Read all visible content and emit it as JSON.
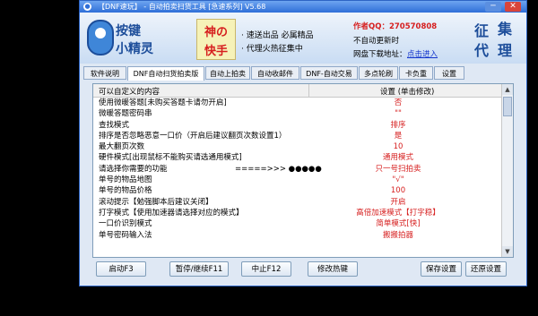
{
  "window": {
    "title": "【DNF速玩】 - 自动拍卖扫货工具 [急速系列] V5.68",
    "title_buttons": [
      "─",
      "✕"
    ]
  },
  "banner": {
    "logo_line1": "按键",
    "logo_line2": "小精灵",
    "shen_line1": "神の",
    "shen_line2": "快手",
    "promo1": "· 速送出品 必属精品",
    "promo2": "· 代理火热征集中",
    "author": "作者QQ：270570808",
    "auto_update": "不自动更新时",
    "download_label": "网盘下载地址：",
    "download_link": "点击进入",
    "zs_chars": [
      "征",
      "集",
      "代",
      "理"
    ]
  },
  "tabs": [
    {
      "label": "软件说明",
      "active": false
    },
    {
      "label": "DNF自动扫货拍卖版",
      "active": true
    },
    {
      "label": "自动上拍卖",
      "active": false
    },
    {
      "label": "自动收邮件",
      "active": false
    },
    {
      "label": "DNF-自动交易",
      "active": false
    },
    {
      "label": "多点轮刷",
      "active": false
    },
    {
      "label": "卡负重",
      "active": false
    },
    {
      "label": "设置",
      "active": false
    }
  ],
  "table": {
    "col1": "可以自定义的内容",
    "col2": "设置 (单击修改)",
    "rows": [
      {
        "key": "使用微暖答题[未购买答题卡请勿开启]",
        "value": "否",
        "color": "#d61e1e"
      },
      {
        "key": "微暖答题密码串",
        "value": "\"\"",
        "color": "#d61e1e"
      },
      {
        "key": "查找模式",
        "value": "排序",
        "color": "#d61e1e"
      },
      {
        "key": "排序是否忽略恶意一口价（开启后建议翻页次数设置1）",
        "value": "是",
        "color": "#d61e1e"
      },
      {
        "key": "最大翻页次数",
        "value": "10",
        "color": "#d61e1e"
      },
      {
        "key": "硬件模式[出现鼠标不能购买请选通用模式]",
        "value": "通用模式",
        "color": "#d61e1e"
      },
      {
        "key": "请选择你需要的功能",
        "extra": "=====>>>      ●●●●●",
        "value": "只一号扫拍卖",
        "color": "#d61e1e"
      },
      {
        "key": "单号的物品地图",
        "value": "\"√\"",
        "color": "#d61e1e"
      },
      {
        "key": "单号的物品价格",
        "value": "100",
        "color": "#d61e1e"
      },
      {
        "key": "滚动提示【勉强脚本后建议关闭】",
        "value": "开启",
        "color": "#d61e1e"
      },
      {
        "key": "打字模式【使用加速器请选择对应的模式】",
        "value": "高倍加速模式【打字稳】",
        "color": "#d61e1e"
      },
      {
        "key": "一口价识别模式",
        "value": "简单模式[快]",
        "color": "#d61e1e"
      },
      {
        "key": "单号密码输入法",
        "value": "搬搬拍器",
        "color": "#d61e1e"
      }
    ]
  },
  "buttons": {
    "start": "启动F3",
    "pause": "暂停/继续F11",
    "stop": "中止F12",
    "hotkey": "修改热键",
    "save": "保存设置",
    "restore": "还原设置"
  }
}
